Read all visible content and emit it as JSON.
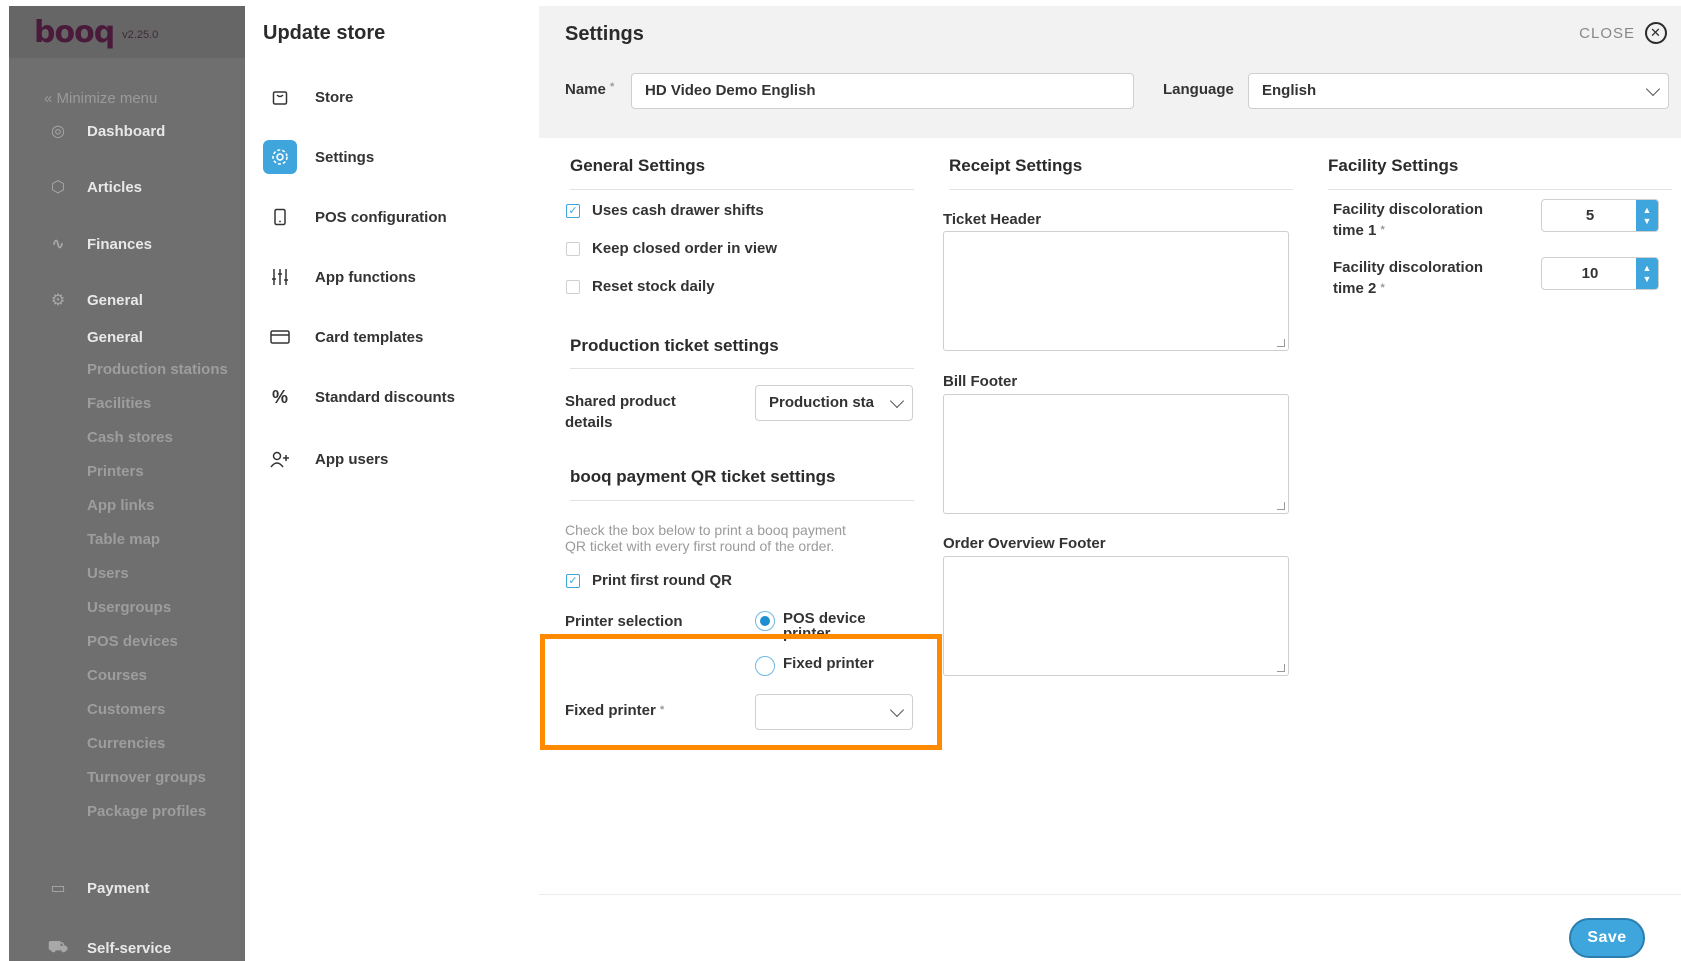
{
  "app": {
    "logo": "booq",
    "version": "v2.25.0"
  },
  "sidebar": {
    "minimize": "« Minimize menu",
    "items": [
      {
        "label": "Dashboard",
        "icon": "compass-icon"
      },
      {
        "label": "Articles",
        "icon": "box-icon"
      },
      {
        "label": "Finances",
        "icon": "pulse-icon"
      },
      {
        "label": "General",
        "icon": "gear-icon"
      }
    ],
    "general_sub": [
      "General",
      "Production stations",
      "Facilities",
      "Cash stores",
      "Printers",
      "App links",
      "Table map",
      "Users",
      "Usergroups",
      "POS devices",
      "Courses",
      "Customers",
      "Currencies",
      "Turnover groups",
      "Package profiles"
    ],
    "bottom_items": [
      {
        "label": "Payment",
        "icon": "card-icon"
      },
      {
        "label": "Self-service",
        "icon": "cart-icon"
      }
    ]
  },
  "store_panel": {
    "title": "Update store",
    "items": [
      {
        "label": "Store",
        "icon": "bag-icon"
      },
      {
        "label": "Settings",
        "icon": "gear-icon"
      },
      {
        "label": "POS configuration",
        "icon": "tablet-icon"
      },
      {
        "label": "App functions",
        "icon": "sliders-icon"
      },
      {
        "label": "Card templates",
        "icon": "card-icon"
      },
      {
        "label": "Standard discounts",
        "icon": "percent-icon"
      },
      {
        "label": "App users",
        "icon": "user-plus-icon"
      }
    ]
  },
  "settings": {
    "title": "Settings",
    "close_label": "CLOSE",
    "name_label": "Name",
    "name_value": "HD Video Demo English",
    "language_label": "Language",
    "language_value": "English",
    "general": {
      "title": "General Settings",
      "checks": [
        {
          "label": "Uses cash drawer shifts",
          "checked": true
        },
        {
          "label": "Keep closed order in view",
          "checked": false
        },
        {
          "label": "Reset stock daily",
          "checked": false
        }
      ]
    },
    "production": {
      "title": "Production ticket settings",
      "shared_label_1": "Shared product",
      "shared_label_2": "details",
      "shared_value": "Production sta"
    },
    "qr": {
      "title": "booq payment QR ticket settings",
      "help_1": "Check the box below to print a booq payment",
      "help_2": "QR ticket with every first round of the order.",
      "print_first_round": "Print first round QR",
      "printer_selection_label": "Printer selection",
      "radio_pos_1": "POS device",
      "radio_pos_2": "printer",
      "radio_fixed": "Fixed printer",
      "fixed_printer_label": "Fixed printer",
      "fixed_printer_value": ""
    },
    "receipt": {
      "title": "Receipt Settings",
      "ticket_header": "Ticket Header",
      "bill_footer": "Bill Footer",
      "order_overview_footer": "Order Overview Footer"
    },
    "facility": {
      "title": "Facility Settings",
      "time1_label_1": "Facility discoloration",
      "time1_label_2": "time 1",
      "time1_value": "5",
      "time2_label_1": "Facility discoloration",
      "time2_label_2": "time 2",
      "time2_value": "10"
    },
    "save_label": "Save"
  },
  "colors": {
    "accent": "#3ea6dc",
    "highlight": "#ff8a00",
    "sidebar": "#6f6f6f"
  }
}
